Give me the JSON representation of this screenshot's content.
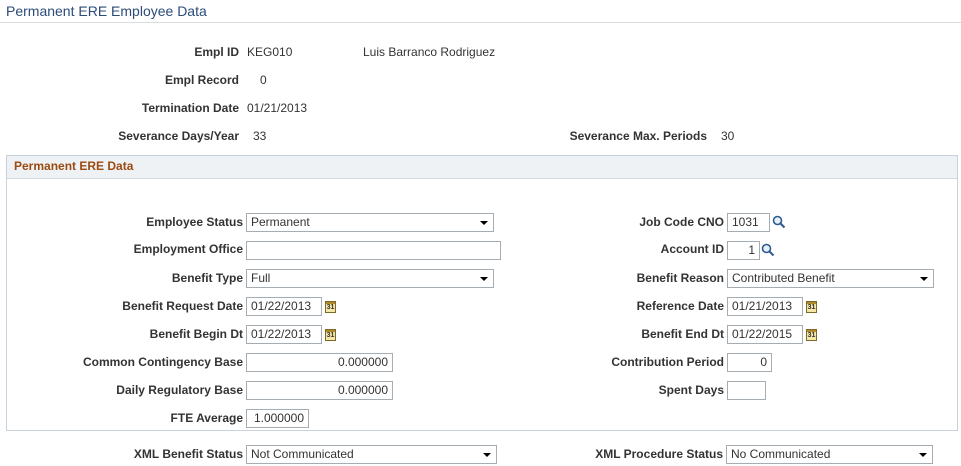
{
  "page": {
    "title": "Permanent ERE Employee Data"
  },
  "header": {
    "empl_id_label": "Empl ID",
    "empl_id": "KEG010",
    "employee_name": "Luis Barranco Rodriguez",
    "empl_record_label": "Empl Record",
    "empl_record": "0",
    "termination_date_label": "Termination Date",
    "termination_date": "01/21/2013",
    "severance_days_label": "Severance Days/Year",
    "severance_days": "33",
    "severance_max_label": "Severance Max. Periods",
    "severance_max": "30"
  },
  "section": {
    "title": "Permanent ERE Data",
    "employee_status_label": "Employee Status",
    "employee_status": "Permanent",
    "employment_office_label": "Employment Office",
    "employment_office": "",
    "benefit_type_label": "Benefit Type",
    "benefit_type": "Full",
    "benefit_request_date_label": "Benefit Request Date",
    "benefit_request_date": "01/22/2013",
    "benefit_begin_label": "Benefit Begin Dt",
    "benefit_begin": "01/22/2013",
    "common_contingency_label": "Common Contingency Base",
    "common_contingency": "0.000000",
    "daily_regulatory_label": "Daily Regulatory Base",
    "daily_regulatory": "0.000000",
    "fte_average_label": "FTE Average",
    "fte_average": "1.000000",
    "job_code_label": "Job Code CNO",
    "job_code": "1031",
    "account_id_label": "Account ID",
    "account_id": "1",
    "benefit_reason_label": "Benefit Reason",
    "benefit_reason": "Contributed Benefit",
    "reference_date_label": "Reference Date",
    "reference_date": "01/21/2013",
    "benefit_end_label": "Benefit End Dt",
    "benefit_end": "01/22/2015",
    "contribution_period_label": "Contribution Period",
    "contribution_period": "0",
    "spent_days_label": "Spent Days",
    "spent_days": ""
  },
  "footer": {
    "xml_benefit_status_label": "XML Benefit Status",
    "xml_benefit_status": "Not Communicated",
    "xml_procedure_status_label": "XML Procedure Status",
    "xml_procedure_status": "No Communicated"
  },
  "icons": {
    "lookup": "magnifier-icon",
    "calendar": "calendar-icon",
    "calendar_glyph": "31"
  },
  "colors": {
    "title": "#2b4b7a",
    "section_title": "#9c4a10",
    "section_header_bg": "#eef2f4",
    "border": "#a5acb2"
  }
}
